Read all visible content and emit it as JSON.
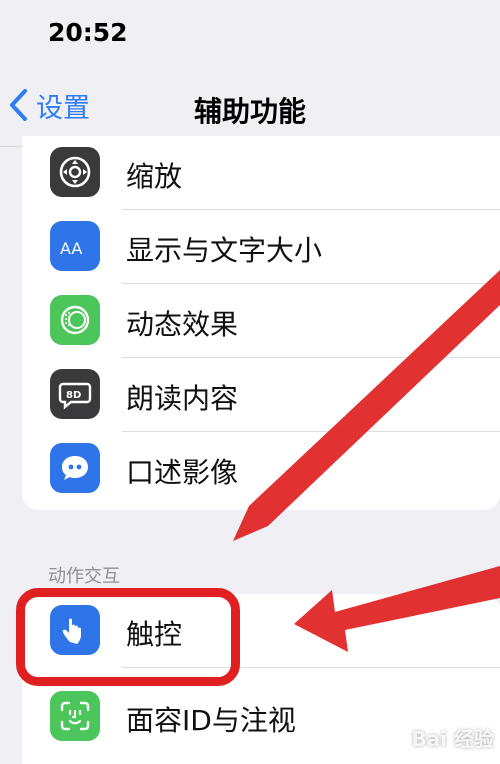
{
  "status_bar": {
    "time": "20:52"
  },
  "nav": {
    "back_label": "设置",
    "title": "辅助功能"
  },
  "vision_items": [
    {
      "label": "缩放",
      "icon": "zoom-icon",
      "icon_color": "#3a3a3c"
    },
    {
      "label": "显示与文字大小",
      "icon": "text-size-icon",
      "icon_color": "#2f74e8"
    },
    {
      "label": "动态效果",
      "icon": "motion-icon",
      "icon_color": "#4cc55a"
    },
    {
      "label": "朗读内容",
      "icon": "speech-icon",
      "icon_color": "#3a3a3c"
    },
    {
      "label": "口述影像",
      "icon": "audio-description-icon",
      "icon_color": "#2f74e8"
    }
  ],
  "physical_section": {
    "header": "动作交互",
    "items": [
      {
        "label": "触控",
        "icon": "touch-hand-icon",
        "icon_color": "#2f74e8"
      },
      {
        "label": "面容ID与注视",
        "icon": "face-id-icon",
        "icon_color": "#4cc55a"
      }
    ]
  },
  "annotation": {
    "color": "#e02020"
  },
  "watermark": "Bai 经验"
}
